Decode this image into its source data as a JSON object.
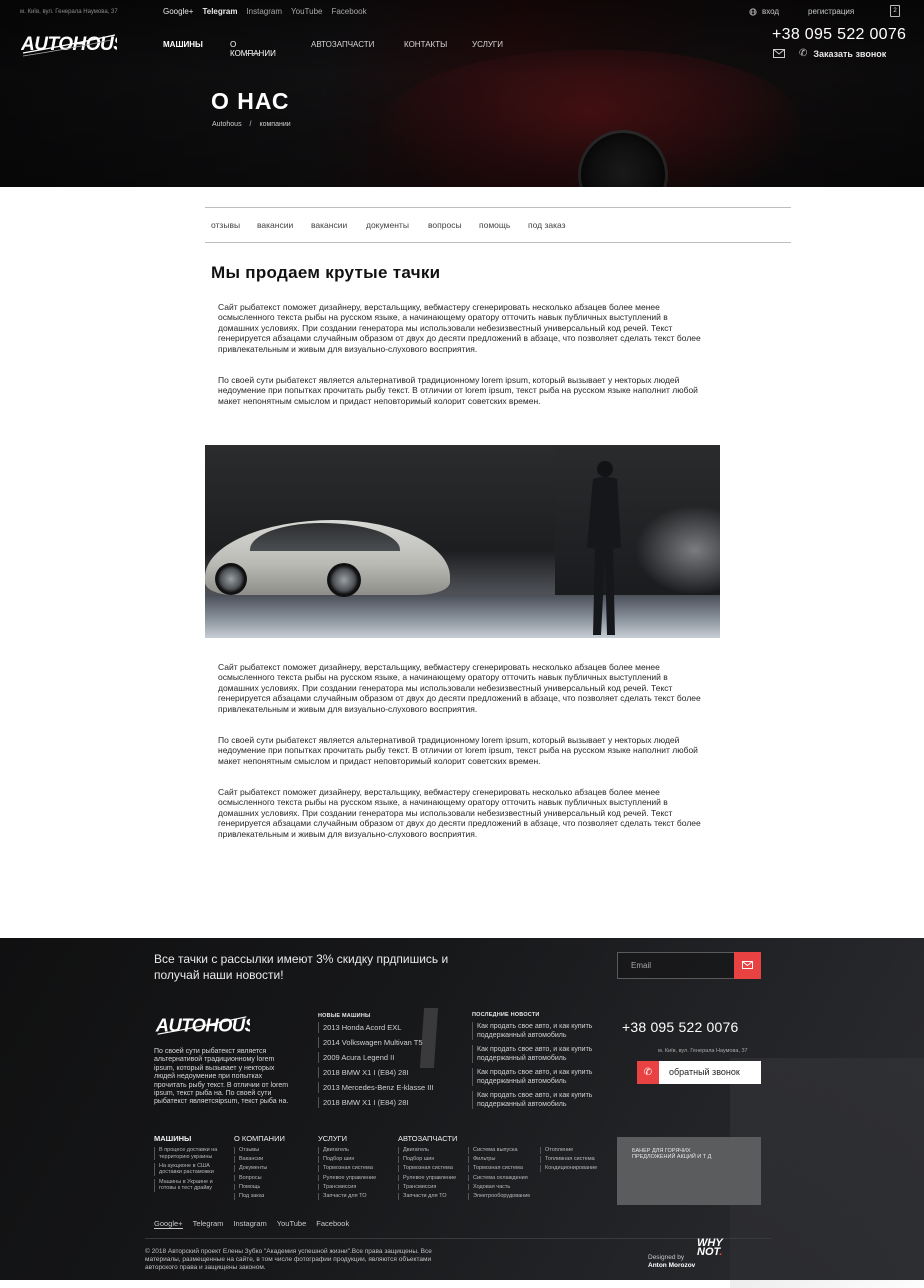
{
  "topbar": {
    "address": "м. Київ, вул. Генерала Наумова, 37",
    "social": [
      "Google+",
      "Telegram",
      "Instagram",
      "YouTube",
      "Facebook"
    ],
    "login_label": "вход",
    "register_label": "регистрация",
    "cart_count": "2"
  },
  "nav": {
    "items": [
      "МАШИНЫ",
      "О КОМПАНИИ",
      "АВТОЗАПЧАСТИ",
      "КОНТАКТЫ",
      "УСЛУГИ"
    ],
    "phone": "+38 095 522 0076",
    "callback_label": "Заказать звонок"
  },
  "hero": {
    "title": "О НАС",
    "breadcrumb": [
      "Autohous",
      "/",
      "компании"
    ]
  },
  "subnav": [
    "отзывы",
    "вакансии",
    "вакансии",
    "документы",
    "вопросы",
    "помощь",
    "под заказ"
  ],
  "article": {
    "heading": "Мы продаем крутые тачки",
    "p1": "Сайт рыбатекст поможет дизайнеру, верстальщику, вебмастеру сгенерировать несколько абзацев более менее осмысленного текста рыбы на русском языке, а начинающему оратору отточить навык публичных выступлений в домашних условиях. При создании генератора мы использовали небезизвестный универсальный код речей. Текст генерируется абзацами случайным образом от двух до десяти предложений в абзаце, что позволяет сделать текст более привлекательным и живым для визуально-слухового восприятия.",
    "p2": "По своей сути рыбатекст является альтернативой традиционному lorem ipsum, который вызывает у некторых людей недоумение при попытках прочитать рыбу текст. В отличии от lorem ipsum, текст рыба на русском языке наполнит любой макет непонятным смыслом и придаст неповторимый колорит советских времен.",
    "p3": "Сайт рыбатекст поможет дизайнеру, верстальщику, вебмастеру сгенерировать несколько абзацев более менее осмысленного текста рыбы на русском языке, а начинающему оратору отточить навык публичных выступлений в домашних условиях. При создании генератора мы использовали небезизвестный универсальный код речей. Текст генерируется абзацами случайным образом от двух до десяти предложений в абзаце, что позволяет сделать текст более привлекательным и живым для визуально-слухового восприятия.",
    "p4": "По своей сути рыбатекст является альтернативой традиционному lorem ipsum, который вызывает у некторых людей недоумение при попытках прочитать рыбу текст. В отличии от lorem ipsum, текст рыба на русском языке наполнит любой макет непонятным смыслом и придаст неповторимый колорит советских времен.",
    "p5": "Сайт рыбатекст поможет дизайнеру, верстальщику, вебмастеру сгенерировать несколько абзацев более менее осмысленного текста рыбы на русском языке, а начинающему оратору отточить навык публичных выступлений в домашних условиях. При создании генератора мы использовали небезизвестный универсальный код речей. Текст генерируется абзацами случайным образом от двух до десяти предложений в абзаце, что позволяет сделать текст более привлекательным и живым для визуально-слухового восприятия."
  },
  "footer": {
    "subscribe_text": "Все тачки с рассылки имеют 3% скидку прдпишись и получай наши новости!",
    "email_placeholder": "Email",
    "about": "По своей сути рыбатекст является альтернативой традиционному lorem ipsum, который вызывает у некторых людей недоумение при попытках прочитать рыбу текст. В отличии от lorem ipsum, текст рыба на. По своей сути рыбатекст являетсяipsum, текст рыба на.",
    "new_cars_title": "НОВЫЕ МАШИНЫ",
    "new_cars": [
      "2013 Honda Acord EXL",
      "2014 Volkswagen Multivan T5",
      "2009 Acura Legend II",
      "2018 BMW X1 I (E84) 28I",
      "2013 Mercedes-Benz E-klasse III",
      "2018 BMW X1 I (E84) 28I"
    ],
    "news_title": "ПОСЛЕДНИЕ НОВОСТИ",
    "news": [
      "Как продать свое авто, и как купить поддержанный автомобиль",
      "Как продать свое авто, и как купить поддержанный автомобиль",
      "Как продать свое авто, и как купить поддержанный автомобиль",
      "Как продать свое авто, и как купить поддержанный автомобиль"
    ],
    "phone": "+38 095 522 0076",
    "address": "м. Київ, вул. Генерала Наумова, 37",
    "callback_label": "обратный звонок",
    "col_cars_title": "МАШИНЫ",
    "col_cars": [
      "В процесе доставки на территорию украины",
      "На аукционе в США доставки растаможки",
      "Машины в Украине и готовы к тест драйву"
    ],
    "col_company_title": "О КОМПАНИИ",
    "col_company": [
      "Отзывы",
      "Вакансии",
      "Документы",
      "Вопросы",
      "Помощь",
      "Под заказ"
    ],
    "col_services_title": "УСЛУГИ",
    "col_services": [
      "Двигатель",
      "Подбор шин",
      "Тормозная система",
      "Рулевое управление",
      "Трансмиссия",
      "Запчасти для ТО"
    ],
    "col_parts_title": "АВТОЗАПЧАСТИ",
    "col_parts_a": [
      "Двигатель",
      "Подбор шин",
      "Тормозная система",
      "Рулевое управление",
      "Трансмиссия",
      "Запчасти для ТО"
    ],
    "col_parts_b": [
      "Система выпуска",
      "Фильтры",
      "Тормозная система",
      "Система охлаждения",
      "Ходовая часть",
      "Электрооборудование"
    ],
    "col_parts_c": [
      "Отопление",
      "Топливная система",
      "Кондиционирование"
    ],
    "banner_text": "БАНЕР ДЛЯ ГОРЯЧИХ ПРЕДЛОЖЕНИЙ АКЦИЙ И Т Д",
    "social": [
      "Google+",
      "Telegram",
      "Instagram",
      "YouTube",
      "Facebook"
    ],
    "copyright": "© 2018 Авторский проект Елены Зубко \"Академия успешной жизни\".Все права защищены. Все материалы, размещенные на сайте, в том числе фотографии продукции, являются объектами авторского права и защищены законом.",
    "designed_by": "Designed by",
    "designer": "Anton Morozov"
  },
  "colors": {
    "accent": "#e94242",
    "dark": "#111112"
  }
}
